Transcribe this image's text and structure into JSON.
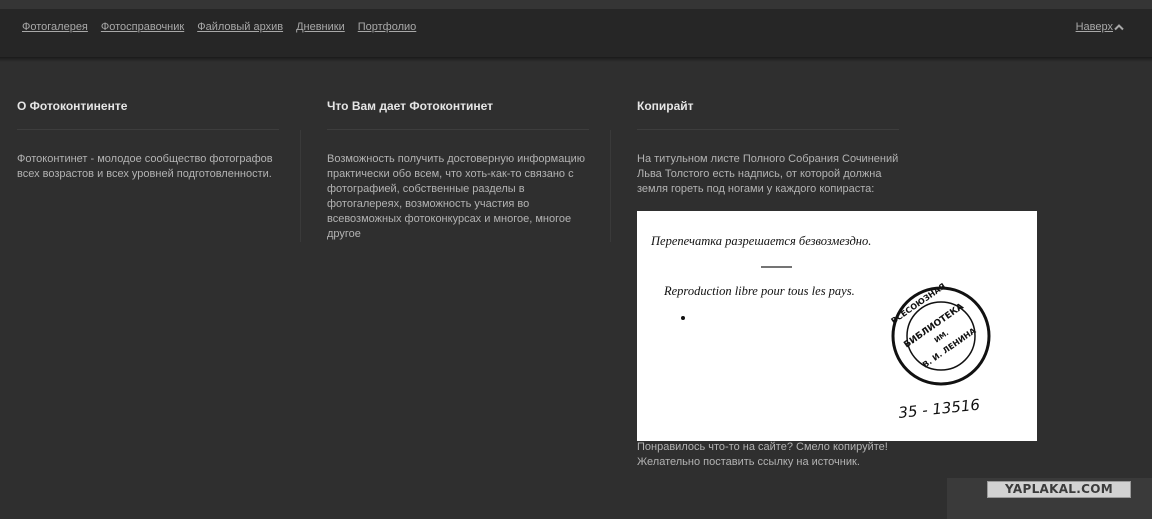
{
  "nav": {
    "items": [
      "Фотогалерея",
      "Фотосправочник",
      "Файловый архив",
      "Дневники",
      "Портфолио"
    ],
    "to_top": "Наверх"
  },
  "columns": [
    {
      "title": "О Фотоконтиненте",
      "text": "Фотоконтинет - молодое сообщество фотографов всех возрастов и всех уровней подготовленности."
    },
    {
      "title": "Что Вам дает Фотоконтинет",
      "text": "Возможность получить достоверную информацию практически обо всем, что хоть-как-то связано с фотографией, собственные разделы в фотогалереях, возможность участия во всевозможных фотоконкурсах и многое, многое другое"
    },
    {
      "title": "Копирайт",
      "text": "На титульном листе Полного Собрания Сочинений Льва Толстого есть надпись, от которой должна земля гореть под ногами у каждого копираста:",
      "text_after": "Понравилось что-то на сайте? Смело копируйте! Желательно поставить ссылку на источник."
    }
  ],
  "copyright_image": {
    "line1": "Перепечатка разрешается безвозмездно.",
    "line2": "Reproduction libre pour tous les pays.",
    "stamp_top": "ВСЕСОЮЗНАЯ",
    "stamp_middle": "БИБЛИОТЕКА",
    "stamp_sub": "ИМ.",
    "stamp_bottom": "В. И. ЛЕНИНА",
    "number": "35 - 13516"
  },
  "watermark": "YAPLAKAL.COM"
}
